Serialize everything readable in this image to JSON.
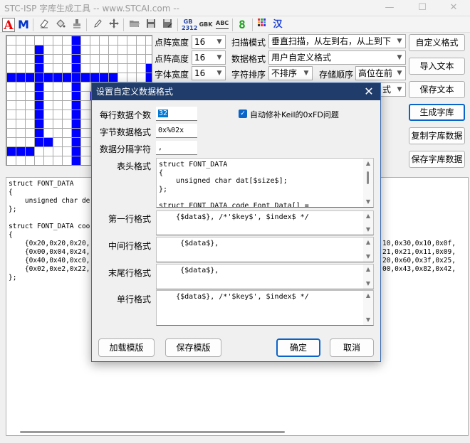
{
  "window": {
    "title": "STC-ISP 字库生成工具 -- www.STCAI.com --",
    "minimize": "—",
    "maximize": "☐",
    "close": "✕"
  },
  "toolbar": {
    "font_color_label": "A",
    "font_mode_label": "M",
    "gb2312_top": "GB",
    "gb2312_bottom": "2312",
    "gbk_label": "GBK",
    "abc_label": "ABC",
    "digit_label": "8",
    "hanzi_label": "汉"
  },
  "settings": {
    "dot_width_label": "点阵宽度",
    "dot_width_value": "16",
    "dot_height_label": "点阵高度",
    "dot_height_value": "16",
    "font_width_label": "字体宽度",
    "font_width_value": "16",
    "scan_mode_label": "扫描模式",
    "scan_mode_value": "垂直扫描，从左到右，从上到下",
    "data_format_label": "数据格式",
    "data_format_value": "用户自定义格式",
    "char_sort_label": "字符排序",
    "char_sort_value": "不排序",
    "storage_order_label": "存储顺序",
    "storage_order_value": "高位在前",
    "partial_combo_value": "式"
  },
  "right_buttons": {
    "custom_format": "自定义格式",
    "import_text": "导入文本",
    "save_text": "保存文本",
    "generate_font": "生成字库",
    "copy_font_data": "复制字库数据",
    "save_font_data": "保存字库数据"
  },
  "glyph": {
    "rows": [
      "0000000100000000",
      "0001000100000000",
      "0001000100000000",
      "0001000100000001",
      "1111111111110001",
      "0001000100000001",
      "0001000101000001",
      "0001000100100011",
      "0001000100010010",
      "0001000100011110",
      "0001000100001100",
      "0001100100000000",
      "1110000100000000",
      "0000000100000000"
    ],
    "on_color": "#0000ff",
    "off_color": "#ffffff",
    "line_color": "#a8a8a8"
  },
  "output": {
    "lines": [
      "struct FONT_DATA",
      "{",
      "    unsigned char de",
      "};",
      "",
      "struct FONT_DATA coo",
      "{",
      "    {0x20,0x20,0x20,",
      "    {0x00,0x04,0x24,",
      "    {0x40,0x40,0xc0,",
      "    {0x02,0xe2,0x22,",
      "};"
    ],
    "right_lines": [
      "10,0x30,0x10,0x0f,",
      "21,0x21,0x11,0x09,",
      "20,0x60,0x3f,0x25,",
      "00,0x43,0x82,0x42,"
    ]
  },
  "dialog": {
    "title": "设置自定义数据格式",
    "close": "✕",
    "per_row_label": "每行数据个数",
    "per_row_value": "32",
    "byte_format_label": "字节数据格式",
    "byte_format_value": "0x%02x",
    "separator_label": "数据分隔字符",
    "separator_value": ",",
    "auto_fix_label": "自动修补Keil的0xFD问题",
    "auto_fix_checked": true,
    "header_label": "表头格式",
    "header_lines": [
      "struct FONT_DATA",
      "{",
      "    unsigned char dat[$size$];",
      "};",
      "",
      "struct FONT_DATA code Font_Data[] ="
    ],
    "first_row_label": "第一行格式",
    "first_row_value": "    {$data$}, /*'$key$', $index$ */",
    "middle_row_label": "中间行格式",
    "middle_row_value": "     {$data$},",
    "last_row_label": "末尾行格式",
    "last_row_value": "     {$data$},",
    "single_row_label": "单行格式",
    "single_row_value": "    {$data$}, /*'$key$', $index$ */",
    "load_template": "加载模版",
    "save_template": "保存模版",
    "ok": "确定",
    "cancel": "取消"
  }
}
